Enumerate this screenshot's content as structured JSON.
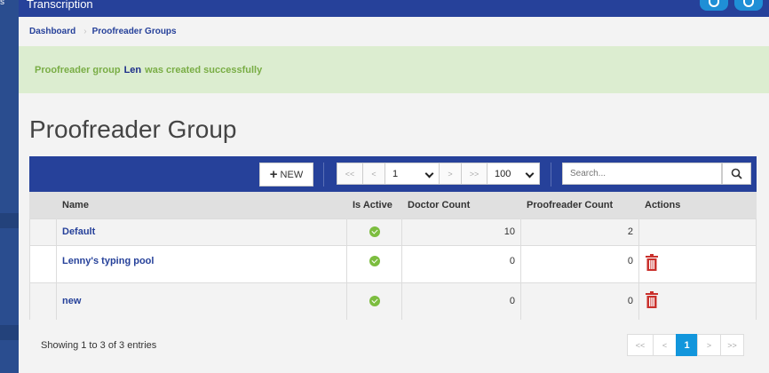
{
  "header": {
    "app_title": "Transcription",
    "sidebar_fragment": "s"
  },
  "breadcrumb": {
    "items": [
      "Dashboard",
      "Proofreader Groups"
    ]
  },
  "alert": {
    "prefix": "Proofreader group",
    "group_name": "Len",
    "suffix": "was created successfully"
  },
  "page": {
    "title": "Proofreader Group"
  },
  "toolbar": {
    "new_label": "NEW",
    "new_icon": "+",
    "pager": {
      "first": "<<",
      "prev": "<",
      "page": "1",
      "next": ">",
      "last": ">>"
    },
    "page_size": "100",
    "search_placeholder": "Search..."
  },
  "table": {
    "columns": [
      "",
      "Name",
      "Is Active",
      "Doctor Count",
      "Proofreader Count",
      "Actions"
    ],
    "rows": [
      {
        "name": "Default",
        "active": true,
        "doctor_count": "10",
        "proofreader_count": "2",
        "deletable": false
      },
      {
        "name": "Lenny's typing pool",
        "active": true,
        "doctor_count": "0",
        "proofreader_count": "0",
        "deletable": true
      },
      {
        "name": "new",
        "active": true,
        "doctor_count": "0",
        "proofreader_count": "0",
        "deletable": true
      }
    ]
  },
  "footer": {
    "showing": "Showing 1 to 3 of 3 entries",
    "pager": {
      "first": "<<",
      "prev": "<",
      "page": "1",
      "next": ">",
      "last": ">>"
    }
  },
  "colors": {
    "primary": "#26419a",
    "accent": "#1296dc",
    "success": "#7cbd3f",
    "danger": "#c9302c",
    "alert_bg": "#dcedd0"
  }
}
